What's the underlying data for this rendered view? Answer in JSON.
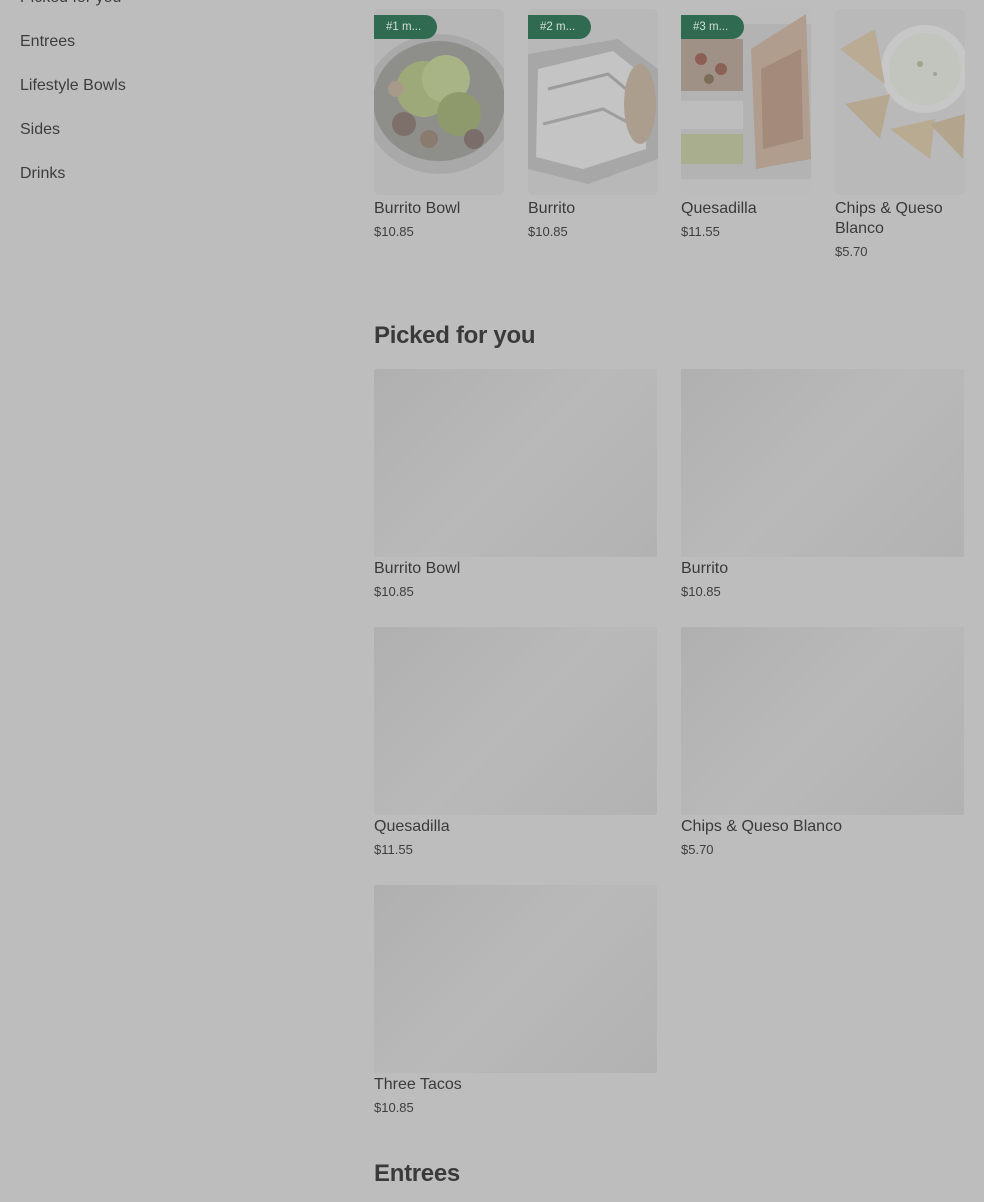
{
  "sidebar": {
    "items": [
      {
        "label": "Picked for you"
      },
      {
        "label": "Entrees"
      },
      {
        "label": "Lifestyle Bowls"
      },
      {
        "label": "Sides"
      },
      {
        "label": "Drinks"
      }
    ]
  },
  "popular": {
    "items": [
      {
        "badge": "#1 m...",
        "name": "Burrito Bowl",
        "price": "$10.85"
      },
      {
        "badge": "#2 m...",
        "name": "Burrito",
        "price": "$10.85"
      },
      {
        "badge": "#3 m...",
        "name": "Quesadilla",
        "price": "$11.55"
      },
      {
        "badge": "",
        "name": "Chips & Queso Blanco",
        "price": "$5.70"
      }
    ]
  },
  "picked": {
    "title": "Picked for you",
    "items": [
      {
        "name": "Burrito Bowl",
        "price": "$10.85"
      },
      {
        "name": "Burrito",
        "price": "$10.85"
      },
      {
        "name": "Quesadilla",
        "price": "$11.55"
      },
      {
        "name": "Chips & Queso Blanco",
        "price": "$5.70"
      },
      {
        "name": "Three Tacos",
        "price": "$10.85"
      }
    ]
  },
  "entrees": {
    "title": "Entrees"
  },
  "colors": {
    "background": "#bdbdbd",
    "badge": "#2f6a51",
    "text": "#3a3a3a"
  }
}
